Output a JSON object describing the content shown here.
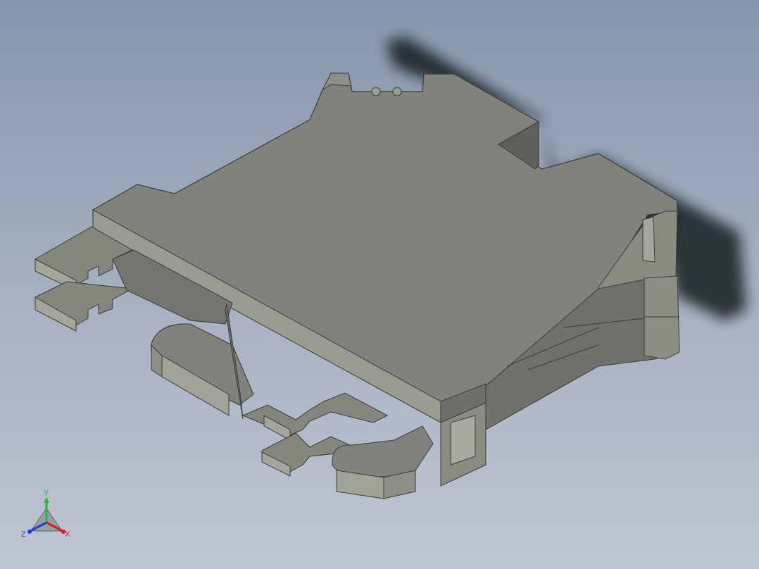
{
  "viewport": {
    "background_top": "#8796ad",
    "background_bottom": "#bfc6d2",
    "part_color": "#7d7f78",
    "shadow_color": "#101418"
  },
  "triad": {
    "x_label": "X",
    "y_label": "Y",
    "z_label": "Z",
    "x_color": "#d41e1e",
    "y_color": "#22b83a",
    "z_color": "#1e3fd4"
  }
}
